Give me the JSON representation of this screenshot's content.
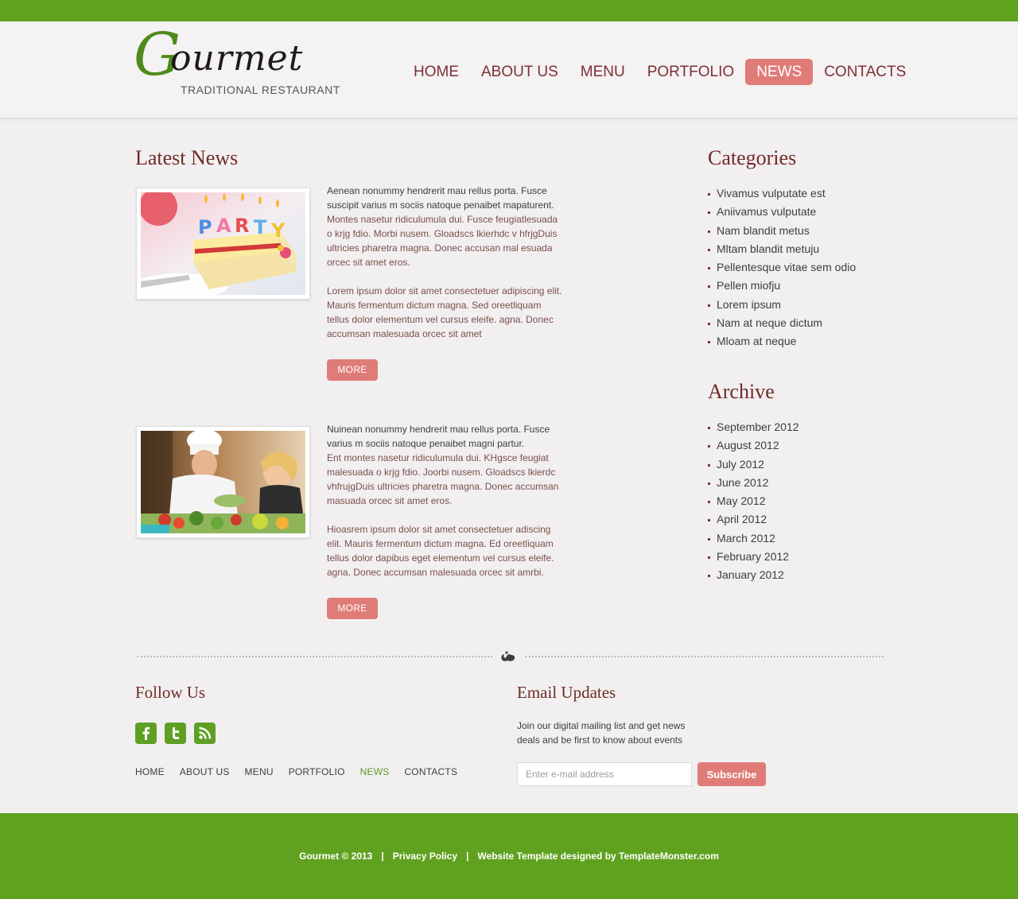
{
  "logo": {
    "initial": "G",
    "rest": "ourmet",
    "tagline": "TRADITIONAL RESTAURANT"
  },
  "nav": [
    {
      "label": "HOME",
      "active": false
    },
    {
      "label": "ABOUT US",
      "active": false
    },
    {
      "label": "MENU",
      "active": false
    },
    {
      "label": "PORTFOLIO",
      "active": false
    },
    {
      "label": "NEWS",
      "active": true
    },
    {
      "label": "CONTACTS",
      "active": false
    }
  ],
  "news": {
    "title": "Latest News",
    "posts": [
      {
        "image": "party-cake-photo",
        "intro": "Aenean nonummy hendrerit mau rellus porta. Fusce suscipit varius m sociis natoque penaibet mapaturent.",
        "body": "Montes nasetur ridiculumula dui. Fusce feugiatlesuada o krjg fdio. Morbi nusem. Gloadscs lkierhdc v hfrjgDuis ultricies pharetra magna. Donec accusan mal esuada orcec sit amet eros.",
        "extra": "Lorem ipsum dolor sit amet consectetuer adipiscing elit. Mauris fermentum dictum magna. Sed oreetliquam tellus dolor elementum vel cursus eleife. agna. Donec accumsan malesuada orcec sit amet",
        "more_label": "MORE"
      },
      {
        "image": "chefs-cooking-photo",
        "intro": "Nuinean nonummy hendrerit mau rellus porta. Fusce varius m sociis natoque penaibet magni partur.",
        "body": "Ent montes nasetur ridiculumula dui. KHgsce feugiat malesuada o krjg fdio. Joorbi nusem. Gloadscs lkierdc vhfrujgDuis ultricies pharetra magna. Donec accumsan masuada orcec sit amet eros.",
        "extra": "Hioasrem ipsum dolor sit amet consectetuer adiscing elit. Mauris fermentum dictum magna. Ed oreetliquam tellus dolor dapibus eget elementum vel cursus eleife. agna. Donec accumsan malesuada orcec sit amrbi.",
        "more_label": "MORE"
      }
    ]
  },
  "categories": {
    "title": "Categories",
    "items": [
      "Vivamus vulputate est",
      "Aniivamus vulputate",
      "Nam blandit metus",
      "Mltam blandit metuju",
      "Pellentesque vitae sem odio",
      "Pellen miofju",
      "Lorem ipsum",
      "Nam at neque dictum",
      "Mloam at neque"
    ]
  },
  "archive": {
    "title": "Archive",
    "items": [
      "September 2012",
      "August 2012",
      "July 2012",
      "June 2012",
      "May 2012",
      "April 2012",
      "March 2012",
      "February 2012",
      "January 2012"
    ]
  },
  "follow": {
    "title": "Follow Us",
    "icons": [
      "facebook-icon",
      "twitter-icon",
      "rss-icon"
    ]
  },
  "footer_nav": [
    {
      "label": "HOME",
      "active": false
    },
    {
      "label": "ABOUT US",
      "active": false
    },
    {
      "label": "MENU",
      "active": false
    },
    {
      "label": "PORTFOLIO",
      "active": false
    },
    {
      "label": "NEWS",
      "active": true
    },
    {
      "label": "CONTACTS",
      "active": false
    }
  ],
  "email": {
    "title": "Email Updates",
    "description": "Join our digital mailing list and get news deals and be first to know about events",
    "placeholder": "Enter e-mail address",
    "button": "Subscribe"
  },
  "footer": {
    "copyright": "Gourmet © 2013",
    "privacy": "Privacy Policy",
    "credit": "Website Template designed by TemplateMonster.com",
    "separator": "|"
  },
  "colors": {
    "brand_green": "#60a220",
    "accent_pink": "#e07c78",
    "heading_maroon": "#6e2b26",
    "nav_text": "#7c3138"
  }
}
